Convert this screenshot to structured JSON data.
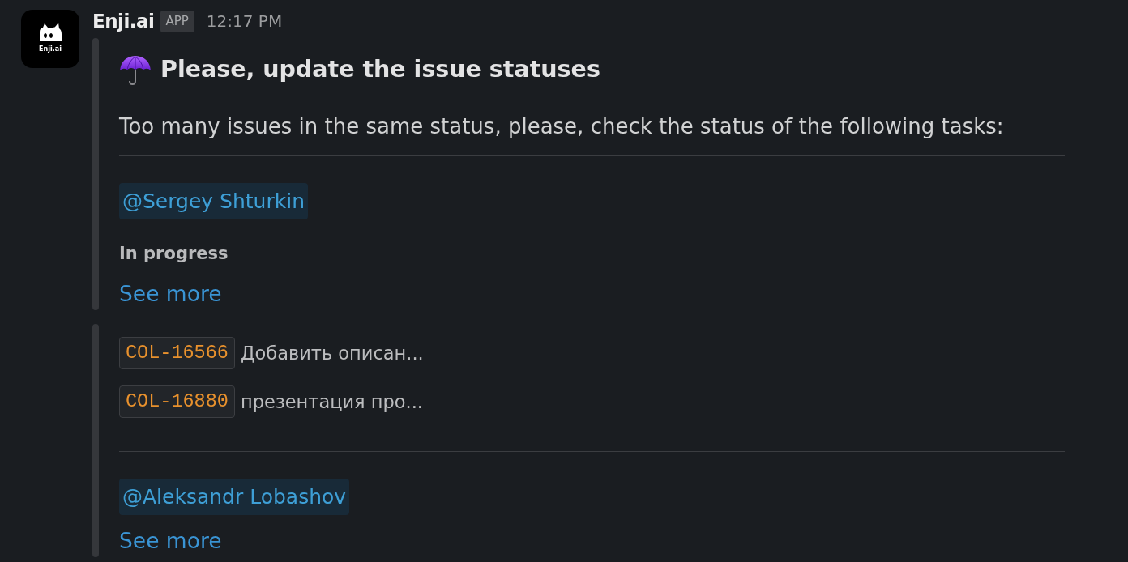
{
  "message": {
    "avatar_label": "Enji.ai",
    "sender": "Enji.ai",
    "badge": "APP",
    "time": "12:17 PM"
  },
  "attachments": [
    {
      "blocks": [
        {
          "kind": "header",
          "text": "Please, update the issue statuses"
        },
        {
          "kind": "text",
          "text": "Too many issues in the same status, please, check the status of the following tasks:"
        },
        {
          "kind": "divider"
        },
        {
          "kind": "mention",
          "text": "@Sergey Shturkin"
        },
        {
          "kind": "status",
          "text": "In progress"
        },
        {
          "kind": "link",
          "text": "See more"
        }
      ]
    },
    {
      "blocks": [
        {
          "kind": "issue",
          "key": "COL-16566",
          "summary": "Добавить описан..."
        },
        {
          "kind": "issue",
          "key": "COL-16880",
          "summary": "презентация про..."
        },
        {
          "kind": "divider"
        },
        {
          "kind": "mention",
          "text": "@Aleksandr Lobashov"
        },
        {
          "kind": "link",
          "text": "See more"
        }
      ]
    }
  ]
}
